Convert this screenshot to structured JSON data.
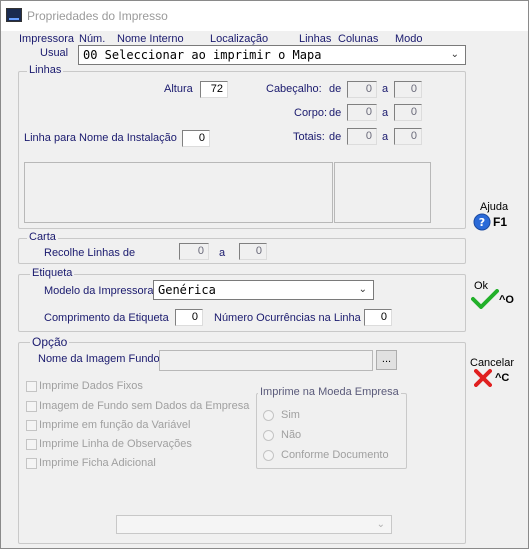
{
  "window": {
    "title": "Propriedades do Impresso"
  },
  "header_cols": {
    "impressora": "Impressora",
    "num": "Núm.",
    "nome_interno": "Nome Interno",
    "localizacao": "Localização",
    "linhas": "Linhas",
    "colunas": "Colunas",
    "modo": "Modo"
  },
  "usual": {
    "label": "Usual",
    "value": "00 Seleccionar ao imprimir o Mapa"
  },
  "linhas_group": {
    "title": "Linhas",
    "altura_label": "Altura",
    "altura_value": "72",
    "cabecalho_label": "Cabeçalho:",
    "corpo_label": "Corpo:",
    "totais_label": "Totais:",
    "de_label": "de",
    "a_label": "a",
    "cabecalho_de": "0",
    "cabecalho_a": "0",
    "corpo_de": "0",
    "corpo_a": "0",
    "totais_de": "0",
    "totais_a": "0",
    "linha_nome_label": "Linha para Nome da Instalação",
    "linha_nome_value": "0"
  },
  "carta_group": {
    "title": "Carta",
    "recolhe_label": "Recolhe Linhas de",
    "de_value": "0",
    "a_label": "a",
    "a_value": "0"
  },
  "etiqueta_group": {
    "title": "Etiqueta",
    "modelo_label": "Modelo da Impressora",
    "modelo_value": "Genérica",
    "comprimento_label": "Comprimento da Etiqueta",
    "comprimento_value": "0",
    "ocorrencias_label": "Número Ocurrências na Linha",
    "ocorrencias_value": "0"
  },
  "opcao_group": {
    "title": "Opção",
    "imagem_label": "Nome da Imagem Fundo",
    "imagem_value": "",
    "ellipsis": "...",
    "checkboxes": [
      "Imprime Dados Fixos",
      "Imagem de Fundo sem Dados da Empresa",
      "Imprime em função da Variável",
      "Imprime Linha de Observações",
      "Imprime Ficha Adicional"
    ],
    "moeda_title": "Imprime na Moeda Empresa",
    "radios": [
      "Sim",
      "Não",
      "Conforme Documento"
    ],
    "bottom_combo": ""
  },
  "buttons": {
    "ajuda": "Ajuda",
    "ajuda_key": "F1",
    "ok": "Ok",
    "ok_key": "^O",
    "cancelar": "Cancelar",
    "cancelar_key": "^C"
  },
  "colors": {
    "label": "#1a1a6e",
    "ok_check": "#22b02a",
    "cancel_x": "#e02020",
    "help_icon": "#2a6ad8"
  }
}
